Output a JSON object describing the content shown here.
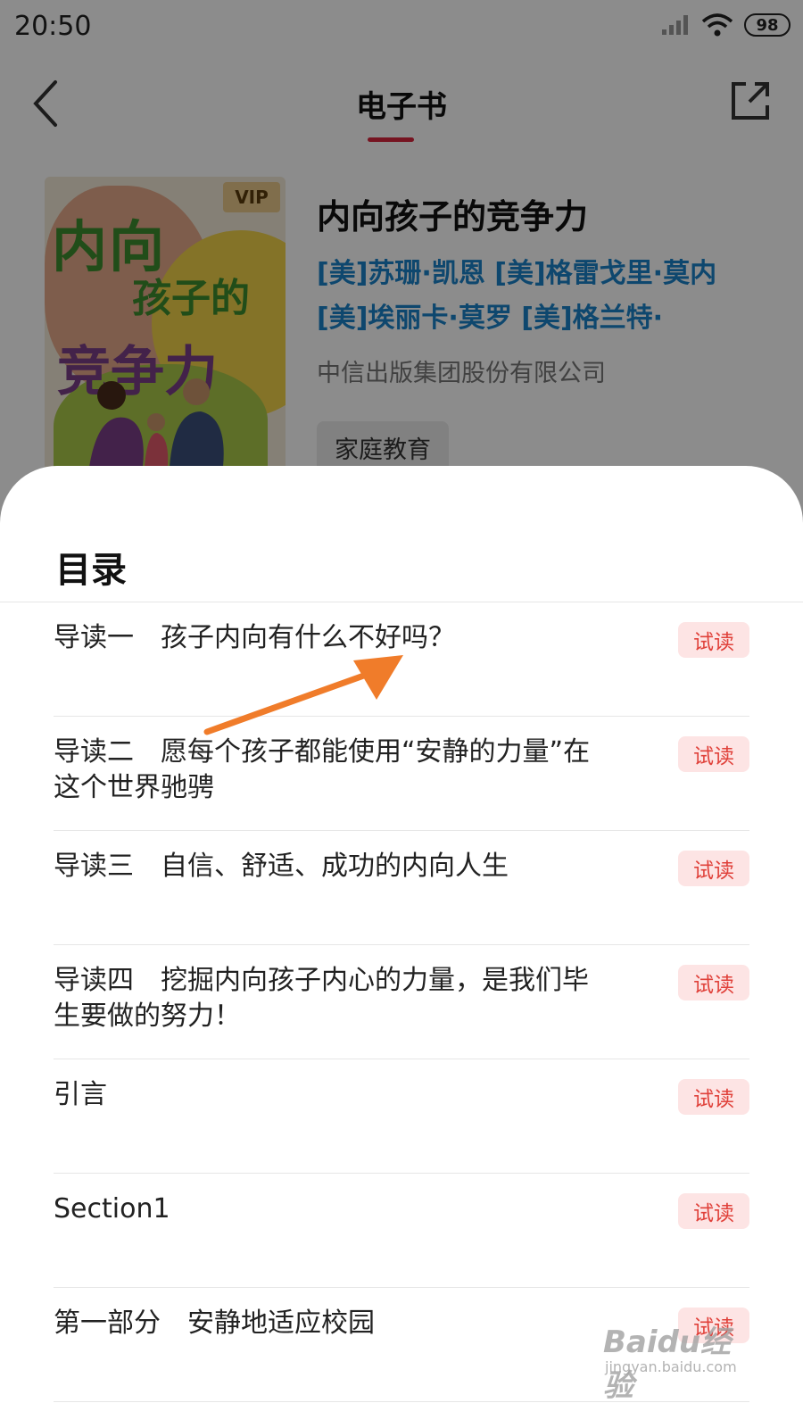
{
  "status": {
    "time": "20:50",
    "battery": "98"
  },
  "header": {
    "title": "电子书"
  },
  "book": {
    "cover_vip": "VIP",
    "cover_title_line1": "内向",
    "cover_title_line2": "孩子的",
    "cover_title_line3": "竞争力",
    "title": "内向孩子的竞争力",
    "authors": "[美]苏珊·凯恩 [美]格雷戈里·莫内 [美]埃丽卡·莫罗 [美]格兰特·",
    "publisher": "中信出版集团股份有限公司",
    "tag": "家庭教育"
  },
  "toc": {
    "title": "目录",
    "trial_label": "试读",
    "items": [
      {
        "text": "导读一　孩子内向有什么不好吗？"
      },
      {
        "text": "导读二　愿每个孩子都能使用“安静的力量”在这个世界驰骋"
      },
      {
        "text": "导读三　自信、舒适、成功的内向人生"
      },
      {
        "text": "导读四　挖掘内向孩子内心的力量，是我们毕生要做的努力！"
      },
      {
        "text": "引言"
      },
      {
        "text": "Section1"
      },
      {
        "text": "第一部分　安静地适应校园"
      }
    ]
  },
  "annotation": {
    "arrow_color": "#f07c2a"
  },
  "watermark": {
    "main": "Baidu经验",
    "sub": "jingyan.baidu.com"
  },
  "colors": {
    "accent": "#d7263d",
    "link": "#1a82c8",
    "trial_bg": "#fde4e4",
    "trial_text": "#e0413a"
  }
}
